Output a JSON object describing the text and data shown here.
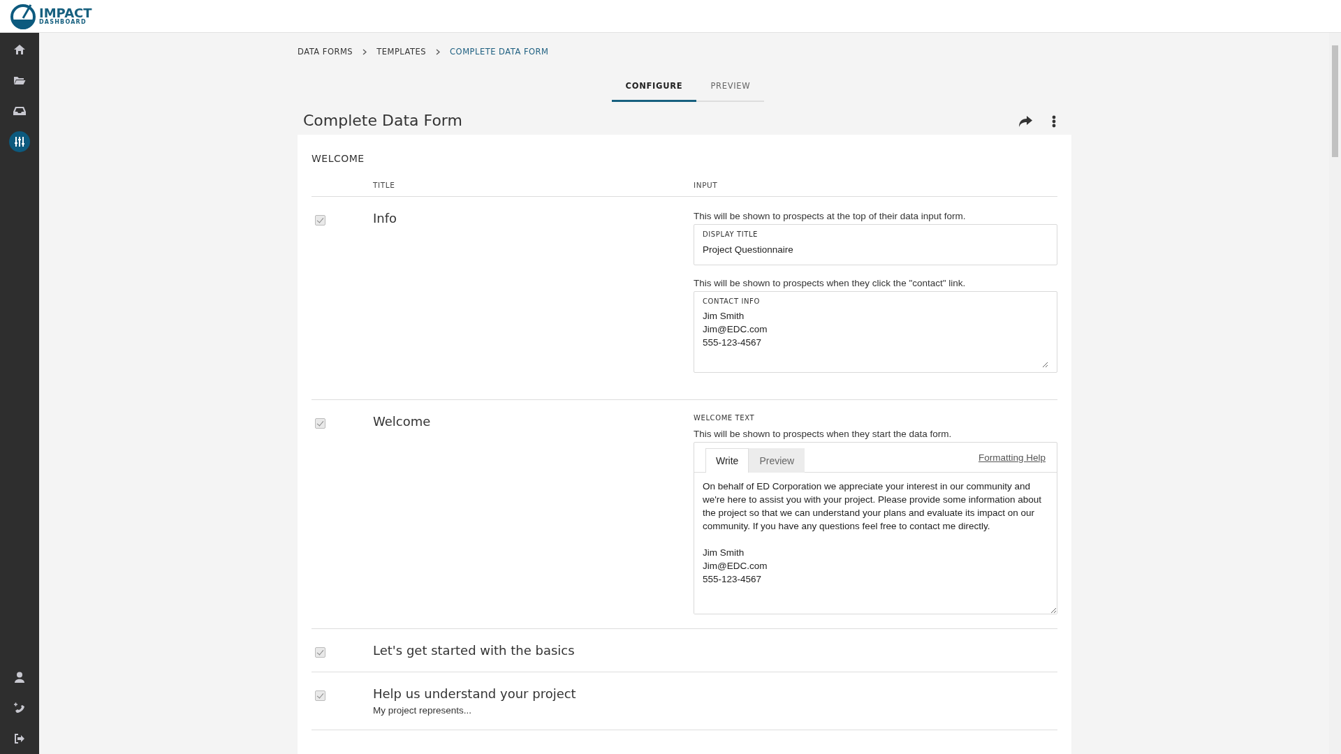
{
  "logo": {
    "name": "IMPACT",
    "tagline": "DASHBOARD"
  },
  "sidebar": {
    "items": [
      {
        "selected": false
      },
      {
        "selected": false
      },
      {
        "selected": false
      },
      {
        "selected": true
      }
    ],
    "bottom_items": [
      {
        "selected": false
      },
      {
        "selected": false
      },
      {
        "selected": false
      }
    ]
  },
  "breadcrumbs": [
    {
      "label": "DATA FORMS",
      "current": false
    },
    {
      "label": "TEMPLATES",
      "current": false
    },
    {
      "label": "COMPLETE DATA FORM",
      "current": true
    }
  ],
  "tabs": [
    {
      "label": "CONFIGURE",
      "selected": true
    },
    {
      "label": "PREVIEW",
      "selected": false
    }
  ],
  "page_title": "Complete Data Form",
  "section": {
    "title": "WELCOME",
    "columns": [
      "TITLE",
      "INPUT"
    ],
    "rows": [
      {
        "checked": true,
        "title": "Info",
        "inputs": [
          {
            "kind": "text",
            "hint": "This will be shown to prospects at the top of their data input form.",
            "label": "DISPLAY TITLE",
            "value": "Project Questionnaire"
          },
          {
            "kind": "textarea",
            "hint": "This will be shown to prospects when they click the \"contact\" link.",
            "label": "CONTACT INFO",
            "value": "Jim Smith\nJim@EDC.com\n555-123-4567"
          }
        ]
      },
      {
        "checked": true,
        "title": "Welcome",
        "inputs": [
          {
            "kind": "editor",
            "label": "WELCOME TEXT",
            "hint": "This will be shown to prospects when they start the data form.",
            "tabs": [
              {
                "label": "Write",
                "selected": true
              },
              {
                "label": "Preview",
                "selected": false
              }
            ],
            "link": "Formatting Help",
            "value": "On behalf of ED Corporation we appreciate your interest in our community and we're here to assist you with your project. Please provide some information about the project so that we can understand your plans and evaluate its impact on our community. If you have any questions feel free to contact me directly.\n\nJim Smith\nJim@EDC.com\n555-123-4567"
          }
        ]
      },
      {
        "checked": true,
        "title": "Let's get started with the basics",
        "inputs": []
      },
      {
        "checked": true,
        "title": "Help us understand your project",
        "subtitle": "My project represents...",
        "inputs": []
      }
    ]
  }
}
